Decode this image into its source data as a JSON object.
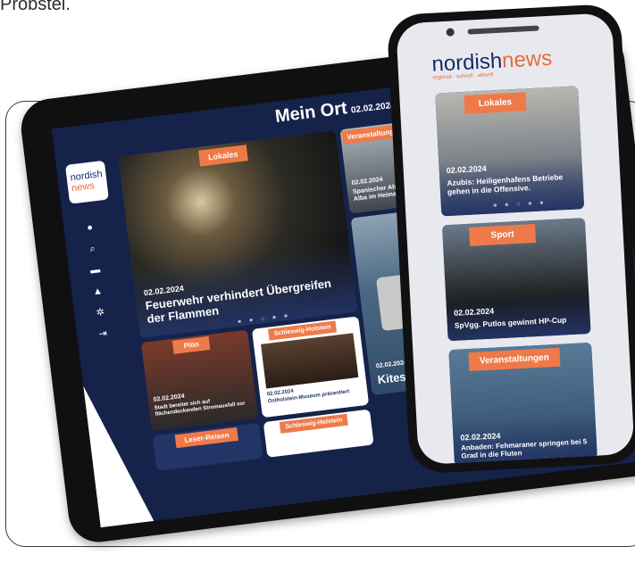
{
  "top_text": "Probstei.",
  "tablet": {
    "title": "Mein Ort",
    "date": "02.02.2024",
    "logo_line1": "nordish",
    "logo_line2": "news",
    "sidebar_icons": [
      "info-icon",
      "search-icon",
      "calendar-icon",
      "user-icon",
      "gear-icon",
      "logout-icon"
    ],
    "cards": [
      {
        "category": "Lokales",
        "date": "02.02.2024",
        "title": "Feuerwehr verhindert Übergreifen der Flammen"
      },
      {
        "category": "Veranstaltungen",
        "date": "02.02.2024",
        "title": "Spanischer Abend mit Duo Alba im Heimat"
      },
      {
        "category": "",
        "date": "02.02.2024",
        "title": "Kitesurfprofi"
      },
      {
        "category": "Plön",
        "date": "02.02.2024",
        "title": "Stadt bereitet sich auf flächendeckenden Stromausfall vor"
      },
      {
        "category": "Schleswig-Holstein",
        "date": "02.02.2024",
        "title": "Ostholstein-Museum präsentiert"
      },
      {
        "category": "Leser-Reisen",
        "date": "",
        "title": ""
      },
      {
        "category": "Schleswig-Holstein",
        "date": "",
        "title": ""
      }
    ]
  },
  "phone": {
    "logo_a": "nordish",
    "logo_b": "news",
    "logo_sub": "regional · schnell · aktuell",
    "cards": [
      {
        "category": "Lokales",
        "date": "02.02.2024",
        "title": "Azubis: Heiligenhafens Betriebe gehen in die Offensive."
      },
      {
        "category": "Sport",
        "date": "02.02.2024",
        "title": "SpVgg. Putlos gewinnt HP-Cup"
      },
      {
        "category": "Veranstaltungen",
        "date": "02.02.2024",
        "title": "Anbaden: Fehmaraner springen bei 5 Grad in die Fluten"
      }
    ]
  },
  "colors": {
    "navy": "#15224a",
    "accent": "#ee7a4a",
    "card": "#233466"
  }
}
